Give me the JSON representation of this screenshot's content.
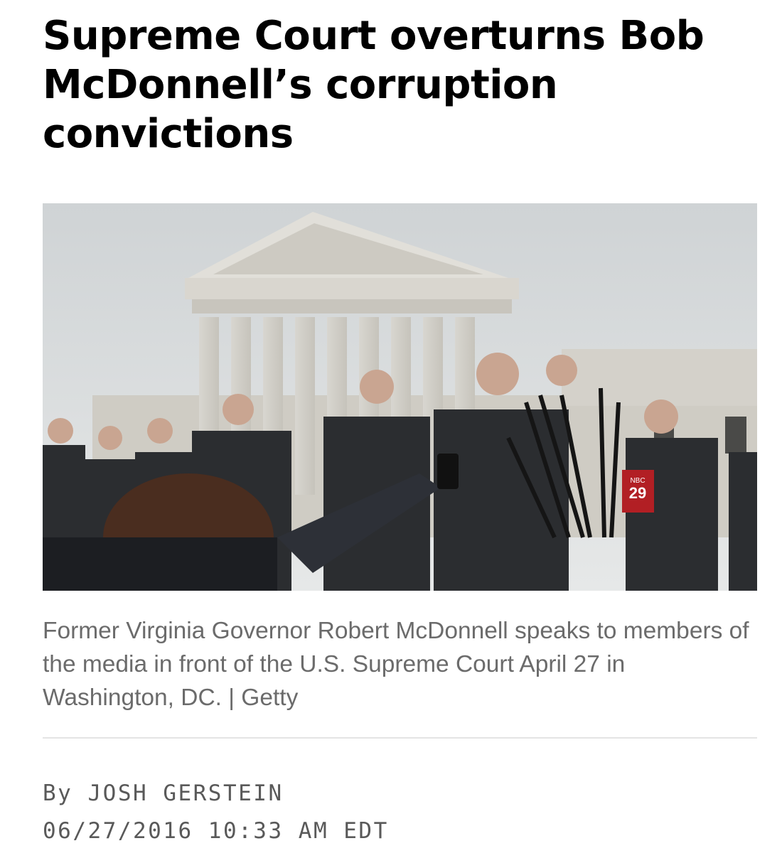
{
  "article": {
    "headline": "Supreme Court overturns Bob McDonnell’s corruption convictions",
    "caption": "Former Virginia Governor Robert McDonnell speaks to members of the media in front of the U.S. Supreme Court April 27 in Washington, DC. | Getty",
    "byline_prefix": "By",
    "author": "JOSH GERSTEIN",
    "timestamp": "06/27/2016 10:33 AM EDT"
  },
  "photo": {
    "badge_text": "29",
    "badge_network": "NBC"
  },
  "colors": {
    "caption_text": "#6b6b6b",
    "meta_text": "#595959",
    "divider": "#e4e4e4",
    "sky": "#d9dcdd",
    "suit": "#2b2d30"
  }
}
